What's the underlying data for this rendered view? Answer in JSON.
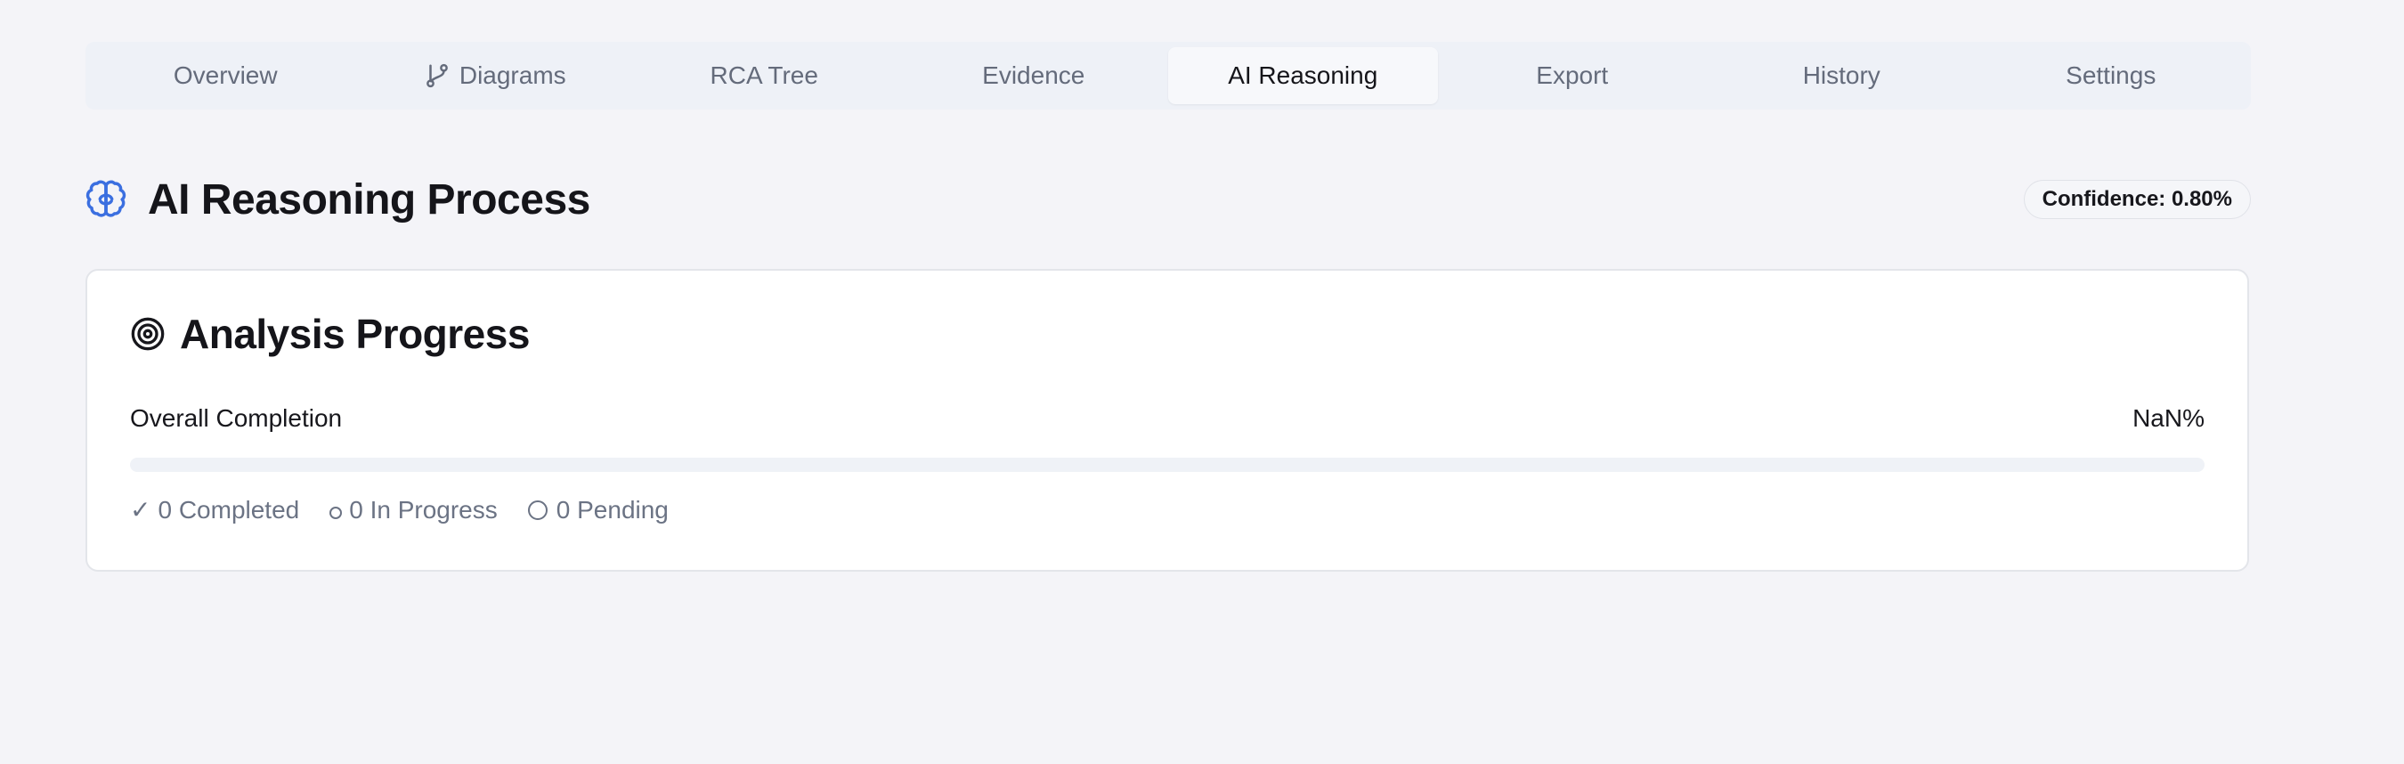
{
  "tabs": [
    {
      "label": "Overview",
      "icon": null,
      "active": false
    },
    {
      "label": "Diagrams",
      "icon": "git-branch-icon",
      "active": false
    },
    {
      "label": "RCA Tree",
      "icon": null,
      "active": false
    },
    {
      "label": "Evidence",
      "icon": null,
      "active": false
    },
    {
      "label": "AI Reasoning",
      "icon": null,
      "active": true
    },
    {
      "label": "Export",
      "icon": null,
      "active": false
    },
    {
      "label": "History",
      "icon": null,
      "active": false
    },
    {
      "label": "Settings",
      "icon": null,
      "active": false
    }
  ],
  "header": {
    "icon": "brain-icon",
    "title": "AI Reasoning Process",
    "confidence": "Confidence: 0.80%"
  },
  "progress_card": {
    "icon": "target-icon",
    "title": "Analysis Progress",
    "overall_label": "Overall Completion",
    "overall_value": "NaN%",
    "completion_fraction": 0,
    "statuses": {
      "completed": "0 Completed",
      "in_progress": "0 In Progress",
      "pending": "0 Pending"
    }
  },
  "colors": {
    "accent": "#3b6fe0",
    "page_bg": "#f4f4f8",
    "muted_text": "#6b7384"
  }
}
